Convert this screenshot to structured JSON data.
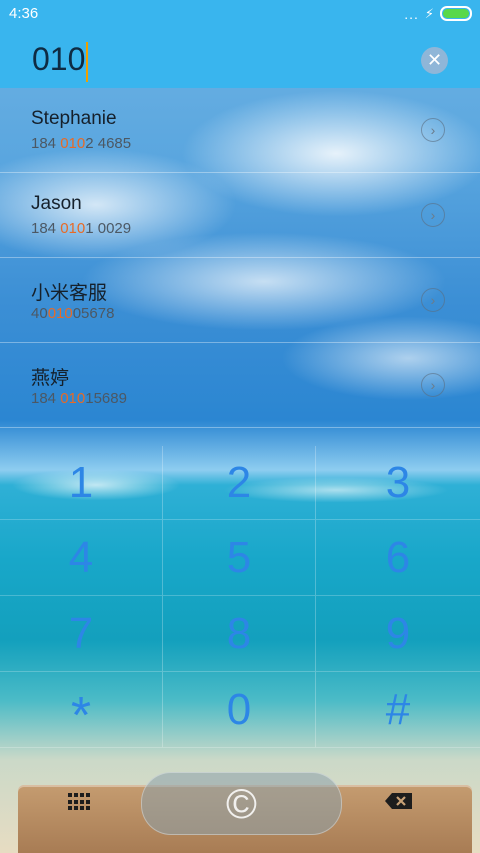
{
  "status": {
    "time": "4:36",
    "dots": "..."
  },
  "search": {
    "query": "010"
  },
  "contacts": [
    {
      "name": "Stephanie",
      "number_pre": "184 ",
      "number_hl": "010",
      "number_post": "2 4685"
    },
    {
      "name": "Jason",
      "number_pre": "184 ",
      "number_hl": "010",
      "number_post": "1 0029"
    },
    {
      "name": "小米客服",
      "number_pre": "40",
      "number_hl": "010",
      "number_post": "05678"
    },
    {
      "name": "燕婷",
      "number_pre": "184 ",
      "number_hl": "010",
      "number_post": "15689"
    }
  ],
  "keypad": [
    "1",
    "2",
    "3",
    "4",
    "5",
    "6",
    "7",
    "8",
    "9",
    "*",
    "0",
    "#"
  ],
  "icons": {
    "clear": "close-icon",
    "chevron": "chevron-right-icon",
    "dialpad": "dialpad-icon",
    "call": "call-icon",
    "backspace": "backspace-icon"
  },
  "colors": {
    "header": "#39b5ee",
    "key": "#2d86e6",
    "highlight": "#e86a25",
    "battery": "#59d84a"
  }
}
